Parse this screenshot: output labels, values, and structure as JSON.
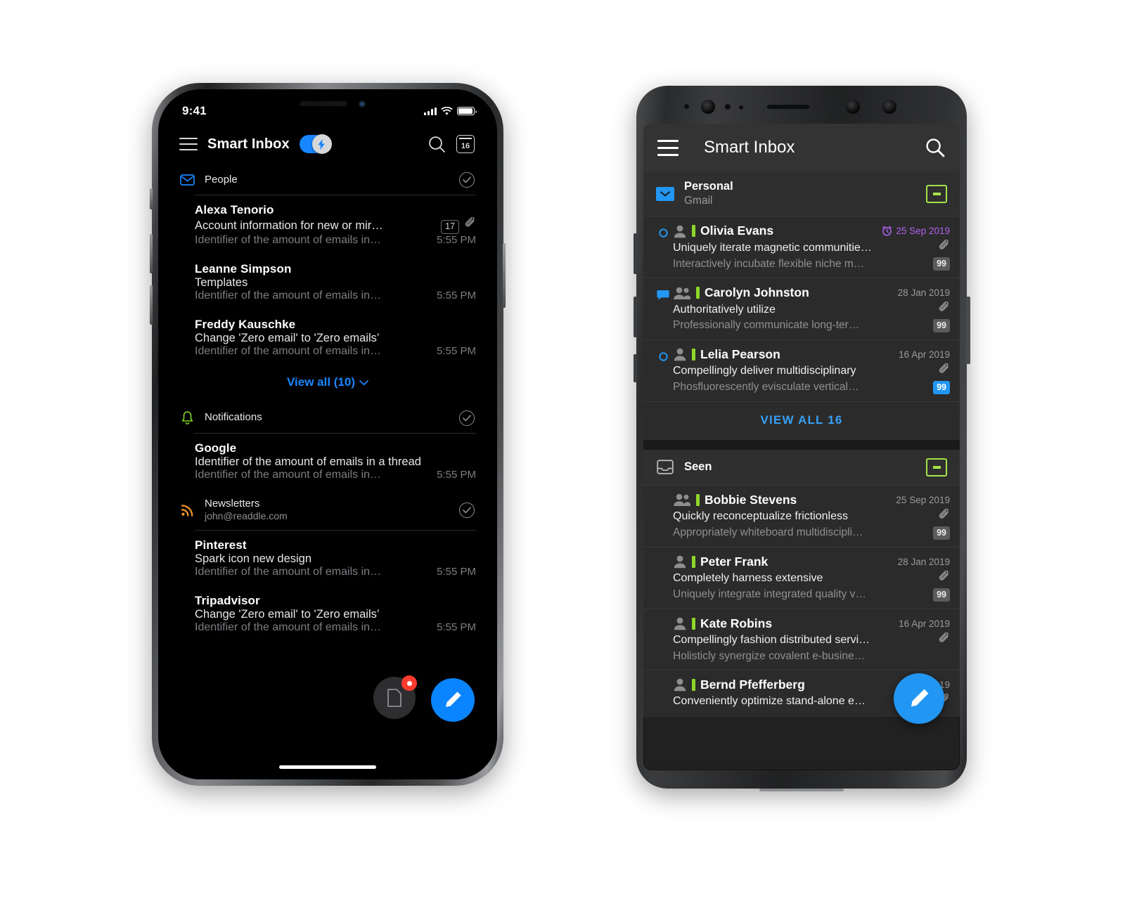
{
  "ios": {
    "statusbar": {
      "time": "9:41",
      "signal_icon": "cellular-signal-icon",
      "wifi_icon": "wifi-icon",
      "battery_icon": "battery-icon"
    },
    "nav": {
      "menu_icon": "hamburger-menu-icon",
      "title": "Smart Inbox",
      "smart_toggle_icon": "lightning-bolt-icon",
      "smart_toggle_on": true,
      "search_icon": "search-icon",
      "calendar_icon": "calendar-icon",
      "calendar_day": "16"
    },
    "groups": [
      {
        "icon": "envelope-icon",
        "icon_color": "#1886ff",
        "title": "People",
        "subtitle": "",
        "check_icon": "check-circle-icon",
        "mails": [
          {
            "from": "Alexa Tenorio",
            "subject": "Account information for new or mir…",
            "preview": "Identifier of the amount of emails in…",
            "time": "5:55 PM",
            "count": "17",
            "attachment": true,
            "unread": true
          },
          {
            "from": "Leanne Simpson",
            "subject": "Templates",
            "preview": "Identifier of the amount of emails in…",
            "time": "5:55 PM",
            "count": "",
            "attachment": false,
            "unread": true
          },
          {
            "from": "Freddy Kauschke",
            "subject": "Change 'Zero email' to 'Zero emails’",
            "preview": "Identifier of the amount of emails in…",
            "time": "5:55 PM",
            "count": "",
            "attachment": false,
            "unread": true
          }
        ],
        "view_all": "View all (10)"
      },
      {
        "icon": "bell-icon",
        "icon_color": "#7ed321",
        "title": "Notifications",
        "subtitle": "",
        "check_icon": "check-circle-icon",
        "mails": [
          {
            "from": "Google",
            "subject": "Identifier of the amount of emails in a thread",
            "preview": "Identifier of the amount of emails in…",
            "time": "5:55 PM",
            "count": "",
            "attachment": false,
            "unread": true
          }
        ],
        "view_all": ""
      },
      {
        "icon": "rss-icon",
        "icon_color": "#f0932b",
        "title": "Newsletters",
        "subtitle": "john@readdle.com",
        "check_icon": "check-circle-icon",
        "mails": [
          {
            "from": "Pinterest",
            "subject": "Spark icon new design",
            "preview": "Identifier of the amount of emails in…",
            "time": "5:55 PM",
            "count": "",
            "attachment": false,
            "unread": true
          },
          {
            "from": "Tripadvisor",
            "subject": "Change 'Zero email' to 'Zero emails’",
            "preview": "Identifier of the amount of emails in…",
            "time": "5:55 PM",
            "count": "",
            "attachment": false,
            "unread": true
          }
        ],
        "view_all": ""
      }
    ],
    "draft_button_icon": "document-icon",
    "compose_button_icon": "pencil-icon"
  },
  "android": {
    "appbar": {
      "menu_icon": "hamburger-menu-icon",
      "title": "Smart Inbox",
      "search_icon": "search-icon"
    },
    "sections": [
      {
        "icon": "envelope-filled-icon",
        "title": "Personal",
        "subtitle": "Gmail",
        "archive_icon": "archive-icon",
        "rows": [
          {
            "status_icon": "unread-circle-icon",
            "status_type": "circle",
            "avatar": "single-person-icon",
            "name": "Olivia Evans",
            "date": "25 Sep 2019",
            "date_style": "snoozed",
            "snooze_icon": "alarm-clock-icon",
            "subject": "Uniquely iterate magnetic communitie…",
            "preview": "Interactively incubate flexible niche m…",
            "attachment_icon": "paperclip-icon",
            "badge": "99",
            "badge_style": "gray"
          },
          {
            "status_icon": "conversation-icon",
            "status_type": "bubble",
            "avatar": "group-person-icon",
            "name": "Carolyn Johnston",
            "date": "28 Jan 2019",
            "date_style": "normal",
            "snooze_icon": "",
            "subject": "Authoritatively utilize",
            "preview": "Professionally communicate long-ter…",
            "attachment_icon": "paperclip-icon",
            "badge": "99",
            "badge_style": "gray"
          },
          {
            "status_icon": "unread-circle-icon",
            "status_type": "circle",
            "avatar": "single-person-icon",
            "name": "Lelia Pearson",
            "date": "16 Apr 2019",
            "date_style": "normal",
            "snooze_icon": "",
            "subject": "Compellingly deliver multidisciplinary",
            "preview": "Phosfluorescently evisculate vertical…",
            "attachment_icon": "paperclip-icon",
            "badge": "99",
            "badge_style": "blue"
          }
        ],
        "view_all": "VIEW ALL 16"
      },
      {
        "icon": "inbox-icon",
        "title": "Seen",
        "subtitle": "",
        "archive_icon": "archive-icon",
        "rows": [
          {
            "status_icon": "",
            "status_type": "none",
            "avatar": "group-person-icon",
            "name": "Bobbie Stevens",
            "date": "25 Sep 2019",
            "date_style": "normal",
            "snooze_icon": "",
            "subject": "Quickly reconceptualize frictionless",
            "preview": "Appropriately whiteboard multidiscipli…",
            "attachment_icon": "paperclip-icon",
            "badge": "99",
            "badge_style": "gray"
          },
          {
            "status_icon": "",
            "status_type": "none",
            "avatar": "single-person-icon",
            "name": "Peter Frank",
            "date": "28 Jan 2019",
            "date_style": "normal",
            "snooze_icon": "",
            "subject": "Completely harness extensive",
            "preview": "Uniquely integrate integrated quality v…",
            "attachment_icon": "paperclip-icon",
            "badge": "99",
            "badge_style": "gray"
          },
          {
            "status_icon": "",
            "status_type": "none",
            "avatar": "single-person-icon",
            "name": "Kate Robins",
            "date": "16 Apr 2019",
            "date_style": "normal",
            "snooze_icon": "",
            "subject": "Compellingly fashion distributed servi…",
            "preview": "Holisticly synergize covalent e-busine…",
            "attachment_icon": "paperclip-icon",
            "badge": "",
            "badge_style": "gray"
          },
          {
            "status_icon": "",
            "status_type": "none",
            "avatar": "single-person-icon",
            "name": "Bernd Pfefferberg",
            "date": "16 Apr 2019",
            "date_style": "normal",
            "snooze_icon": "",
            "subject": "Conveniently optimize stand-alone e…",
            "preview": "",
            "attachment_icon": "paperclip-icon",
            "badge": "",
            "badge_style": "gray"
          }
        ],
        "view_all": ""
      }
    ],
    "compose_button_icon": "pencil-icon"
  },
  "colors": {
    "accent_blue": "#1886ff",
    "android_blue": "#2196f3",
    "green_flag": "#8ed629",
    "archive_green": "#a4e44a",
    "snooze_purple": "#b060ef",
    "badge_red": "#ff3b30",
    "rss_orange": "#f0932b",
    "bell_green": "#7ed321"
  }
}
